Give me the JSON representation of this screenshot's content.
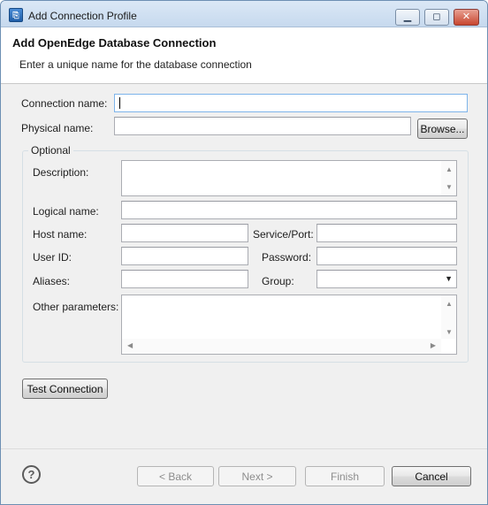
{
  "window": {
    "title": "Add Connection Profile",
    "icon": "openedge-app-icon",
    "controls": {
      "minimize": "minimize-icon",
      "maximize": "maximize-icon",
      "close": "close-icon"
    }
  },
  "header": {
    "title": "Add OpenEdge Database Connection",
    "description": "Enter a unique name for the database connection"
  },
  "form": {
    "connection_name": {
      "label": "Connection name:",
      "value": ""
    },
    "physical_name": {
      "label": "Physical name:",
      "value": ""
    },
    "browse_label": "Browse...",
    "optional": {
      "title": "Optional",
      "description": {
        "label": "Description:",
        "value": ""
      },
      "logical_name": {
        "label": "Logical name:",
        "value": ""
      },
      "host_name": {
        "label": "Host name:",
        "value": ""
      },
      "service_port": {
        "label": "Service/Port:",
        "value": ""
      },
      "user_id": {
        "label": "User ID:",
        "value": ""
      },
      "password": {
        "label": "Password:",
        "value": ""
      },
      "aliases": {
        "label": "Aliases:",
        "value": ""
      },
      "group": {
        "label": "Group:",
        "value": ""
      },
      "other_parameters": {
        "label": "Other parameters:",
        "value": ""
      }
    },
    "test_connection_label": "Test Connection"
  },
  "footer": {
    "back_label": "< Back",
    "next_label": "Next >",
    "finish_label": "Finish",
    "cancel_label": "Cancel",
    "help_icon": "help-icon"
  },
  "colors": {
    "accent": "#7eb4ea",
    "title_gradient_top": "#dbe8f6",
    "close_red": "#c8462f"
  }
}
